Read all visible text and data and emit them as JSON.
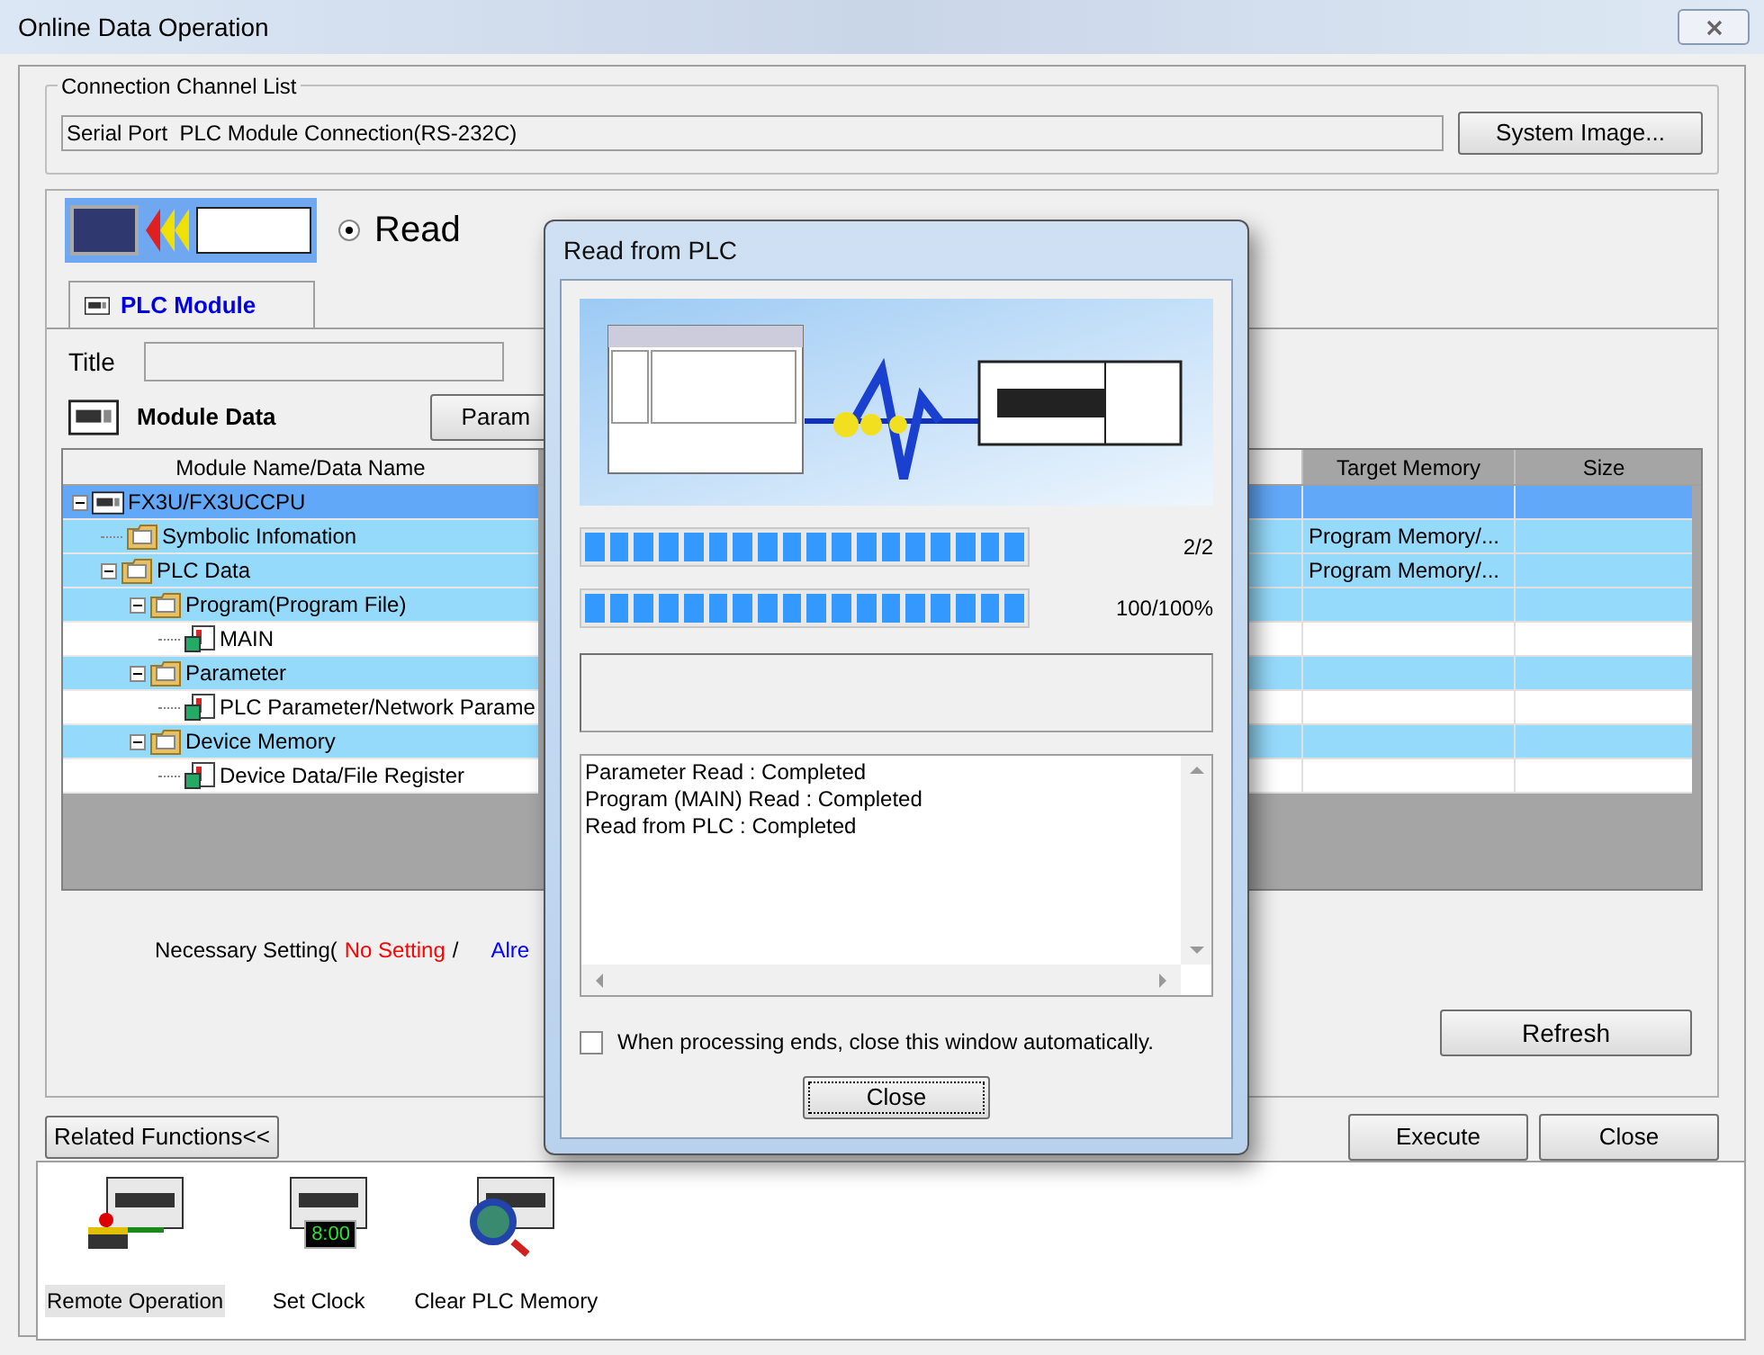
{
  "window": {
    "title": "Online Data Operation"
  },
  "connection": {
    "label": "Connection Channel List",
    "value": "Serial Port  PLC Module Connection(RS-232C)",
    "button": "System Image..."
  },
  "operation": {
    "options": [
      {
        "label": "Read",
        "selected": true
      }
    ]
  },
  "tabs": [
    {
      "label": "PLC Module",
      "selected": true
    }
  ],
  "title_field": {
    "label": "Title"
  },
  "module_data": {
    "label": "Module Data",
    "button": "Param"
  },
  "table": {
    "columns": [
      "Module Name/Data Name",
      "Target Memory",
      "Size"
    ],
    "rows": [
      {
        "name": "FX3U/FX3UCCPU",
        "kind": "cpu",
        "selected": true,
        "expanded": true,
        "children": [
          {
            "name": "Symbolic Infomation",
            "kind": "group",
            "selected": false,
            "target_memory": "Program Memory/..."
          },
          {
            "name": "PLC Data",
            "kind": "group",
            "selected": false,
            "target_memory": "Program Memory/...",
            "expanded": true,
            "children": [
              {
                "name": "Program(Program File)",
                "kind": "group",
                "selected": false,
                "expanded": true,
                "children": [
                  {
                    "name": "MAIN",
                    "kind": "item",
                    "selected": false
                  }
                ]
              },
              {
                "name": "Parameter",
                "kind": "group",
                "selected": false,
                "expanded": true,
                "children": [
                  {
                    "name": "PLC Parameter/Network Parame",
                    "kind": "item",
                    "selected": false
                  }
                ]
              },
              {
                "name": "Device Memory",
                "kind": "group",
                "selected": false,
                "expanded": true,
                "children": [
                  {
                    "name": "Device Data/File Register",
                    "kind": "item",
                    "selected": false
                  }
                ]
              }
            ]
          }
        ]
      }
    ]
  },
  "necessary_setting": {
    "label": "Necessary Setting(",
    "no_setting": "No Setting",
    "separator": "/",
    "already": "Alre"
  },
  "refresh": "Refresh",
  "related_toggle": "Related Functions<<",
  "actions": [
    "Execute",
    "Close"
  ],
  "related_functions": [
    {
      "label": "Remote Operation",
      "kind": "remote",
      "selected": true
    },
    {
      "label": "Set Clock",
      "kind": "clock",
      "clock": "8:00",
      "selected": false
    },
    {
      "label": "Clear PLC Memory",
      "kind": "clear",
      "selected": false
    }
  ],
  "dialog": {
    "title": "Read from PLC",
    "progress": [
      {
        "level": 1,
        "reading": "2/2"
      },
      {
        "level": 1,
        "reading": "100/100%"
      }
    ],
    "log": [
      "Parameter Read : Completed",
      "Program (MAIN) Read : Completed",
      "Read from PLC : Completed"
    ],
    "auto_close": {
      "label": "When processing ends, close this window automatically.",
      "checked": false
    },
    "button": "Close"
  }
}
